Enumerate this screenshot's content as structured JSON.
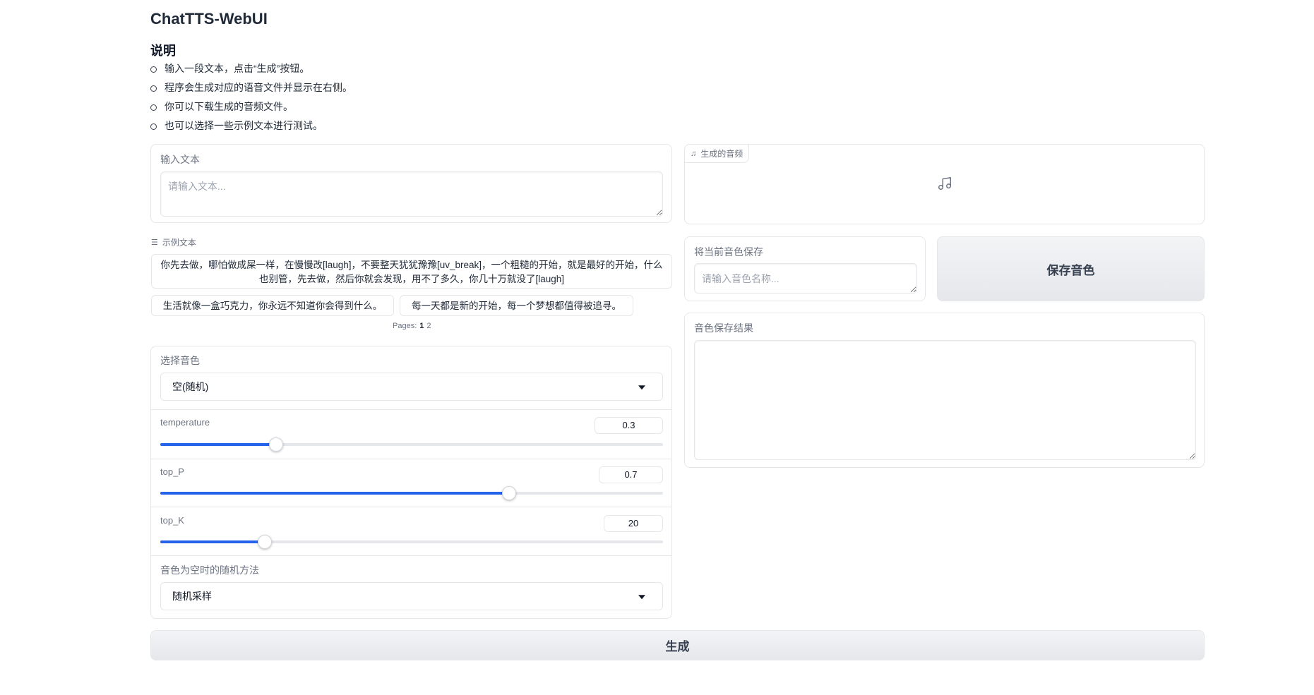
{
  "app": {
    "title": "ChatTTS-WebUI"
  },
  "instructions": {
    "heading": "说明",
    "items": [
      "输入一段文本，点击“生成”按钮。",
      "程序会生成对应的语音文件并显示在右侧。",
      "你可以下载生成的音频文件。",
      "也可以选择一些示例文本进行测试。"
    ]
  },
  "input_text": {
    "label": "输入文本",
    "placeholder": "请输入文本..."
  },
  "examples": {
    "label": "示例文本",
    "items": [
      "你先去做，哪怕做成屎一样，在慢慢改[laugh]，不要整天犹犹豫豫[uv_break]，一个粗糙的开始，就是最好的开始，什么也别管，先去做，然后你就会发现，用不了多久，你几十万就没了[laugh]",
      "生活就像一盒巧克力，你永远不知道你会得到什么。",
      "每一天都是新的开始，每一个梦想都值得被追寻。"
    ],
    "pages_label": "Pages:",
    "pages": [
      "1",
      "2"
    ],
    "current_page": 1
  },
  "voice_select": {
    "label": "选择音色",
    "value": "空(随机)"
  },
  "sliders": {
    "temperature": {
      "label": "temperature",
      "value": "0.3",
      "fraction": 0.23
    },
    "top_p": {
      "label": "top_P",
      "value": "0.7",
      "fraction": 0.694
    },
    "top_k": {
      "label": "top_K",
      "value": "20",
      "fraction": 0.208
    }
  },
  "random_method": {
    "label": "音色为空时的随机方法",
    "value": "随机采样"
  },
  "generate_button": {
    "label": "生成"
  },
  "audio_output": {
    "label": "生成的音频"
  },
  "save_voice": {
    "label": "将当前音色保存",
    "placeholder": "请输入音色名称...",
    "button_label": "保存音色"
  },
  "save_result": {
    "label": "音色保存结果",
    "value": ""
  },
  "colors": {
    "accent": "#2563eb",
    "border": "#e5e7eb",
    "button_bg": "#e5e7eb"
  }
}
